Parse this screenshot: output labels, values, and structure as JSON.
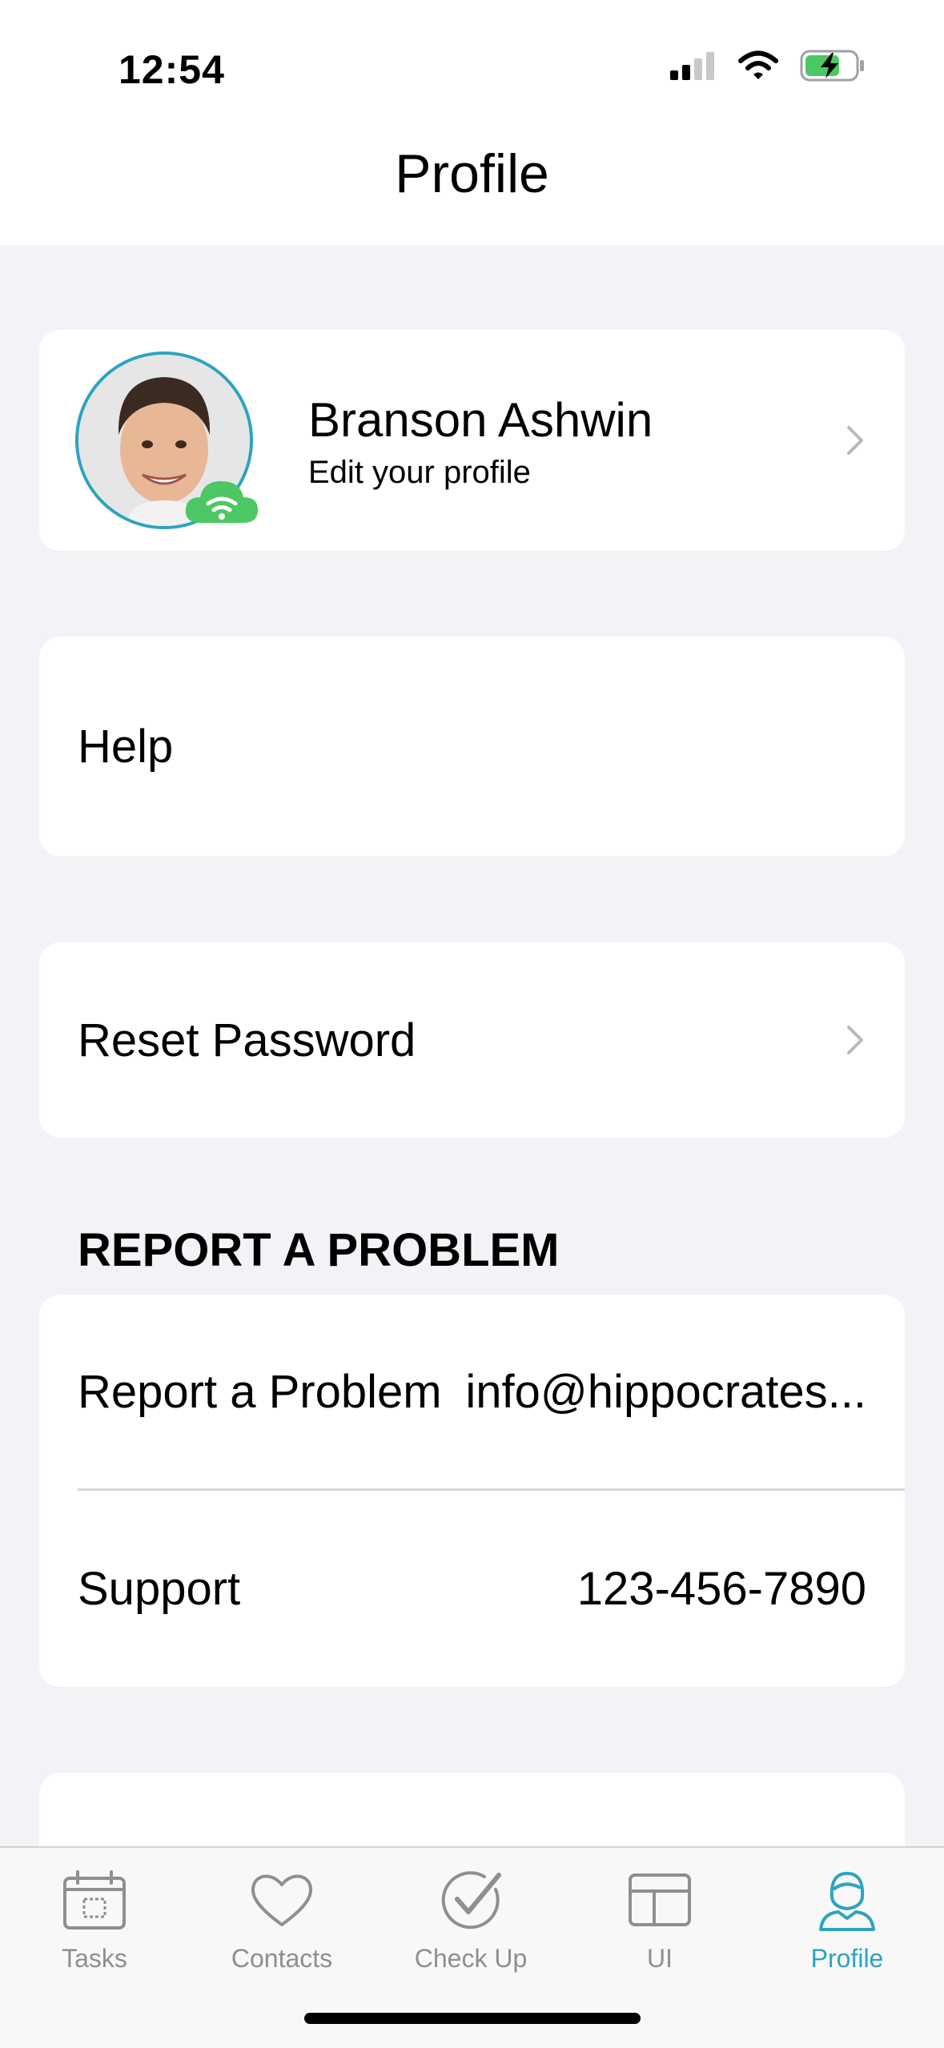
{
  "status_bar": {
    "time": "12:54"
  },
  "header": {
    "title": "Profile"
  },
  "profile": {
    "name": "Branson Ashwin",
    "subtitle": "Edit your profile"
  },
  "menu": {
    "help": "Help",
    "reset_password": "Reset Password"
  },
  "report_section": {
    "title": "REPORT A PROBLEM",
    "rows": [
      {
        "label": "Report a Problem",
        "value": "info@hippocrates..."
      },
      {
        "label": "Support",
        "value": "123-456-7890"
      }
    ]
  },
  "tabs": [
    {
      "label": "Tasks",
      "icon": "calendar-icon"
    },
    {
      "label": "Contacts",
      "icon": "heart-icon"
    },
    {
      "label": "Check Up",
      "icon": "checkmark-icon"
    },
    {
      "label": "UI",
      "icon": "layout-icon"
    },
    {
      "label": "Profile",
      "icon": "person-icon",
      "active": true
    }
  ],
  "colors": {
    "accent": "#2ea3c0",
    "online": "#4cc764",
    "background": "#f2f2f7"
  }
}
